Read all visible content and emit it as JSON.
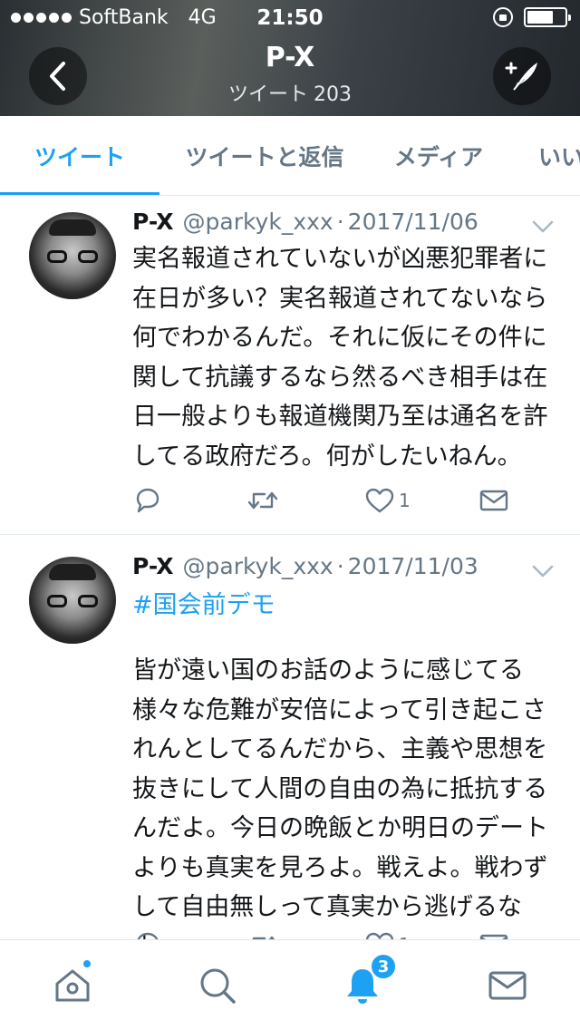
{
  "status_bar": {
    "carrier": "SoftBank",
    "network": "4G",
    "time": "21:50"
  },
  "header": {
    "title": "P-X",
    "tweets_label": "ツイート",
    "tweet_count": "203"
  },
  "tabs": [
    {
      "label": "ツイート",
      "active": true
    },
    {
      "label": "ツイートと返信",
      "active": false
    },
    {
      "label": "メディア",
      "active": false
    },
    {
      "label": "いいね",
      "active": false
    }
  ],
  "tweets": [
    {
      "name": "P-X",
      "handle": "@parkyk_xxx",
      "dot": "·",
      "date": "2017/11/06",
      "text": "実名報道されていないが凶悪犯罪者に在日が多い？実名報道されてないなら何でわかるんだ。それに仮にその件に関して抗議するなら然るべき相手は在日一般よりも報道機関乃至は通名を許してる政府だろ。何がしたいねん。",
      "likes": "1"
    },
    {
      "name": "P-X",
      "handle": "@parkyk_xxx",
      "dot": "·",
      "date": "2017/11/03",
      "hashtag": "#国会前デモ",
      "text": "皆が遠い国のお話のように感じてる様々な危難が安倍によって引き起こされんとしてるんだから、主義や思想を抜きにして人間の自由の為に抵抗するんだよ。今日の晩飯とか明日のデートよりも真実を見ろよ。戦えよ。戦わずして自由無しって真実から逃げるなよ。",
      "likes": "1"
    }
  ],
  "bottom_nav": {
    "notifications_badge": "3"
  },
  "colors": {
    "accent": "#1da1f2",
    "secondary_text": "#657786",
    "divider": "#e1e8ed"
  }
}
